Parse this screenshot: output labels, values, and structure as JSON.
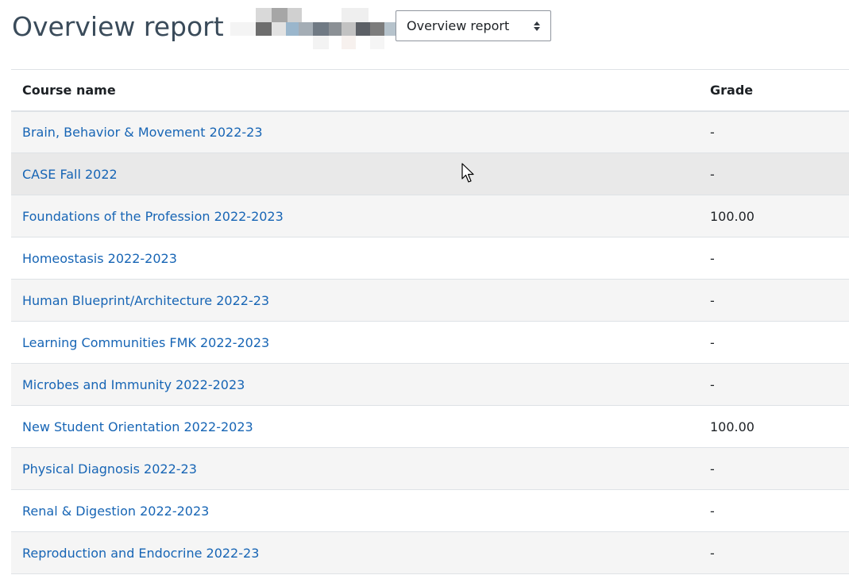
{
  "page": {
    "title": "Overview report"
  },
  "report_selector": {
    "selected": "Overview report"
  },
  "table": {
    "headers": {
      "course_name": "Course name",
      "grade": "Grade"
    },
    "rows": [
      {
        "course": "Brain, Behavior & Movement 2022-23",
        "grade": "-"
      },
      {
        "course": "CASE Fall 2022",
        "grade": "-"
      },
      {
        "course": "Foundations of the Profession 2022-2023",
        "grade": "100.00"
      },
      {
        "course": "Homeostasis 2022-2023",
        "grade": "-"
      },
      {
        "course": "Human Blueprint/Architecture 2022-23",
        "grade": "-"
      },
      {
        "course": "Learning Communities FMK 2022-2023",
        "grade": "-"
      },
      {
        "course": "Microbes and Immunity 2022-2023",
        "grade": "-"
      },
      {
        "course": "New Student Orientation 2022-2023",
        "grade": "100.00"
      },
      {
        "course": "Physical Diagnosis 2022-23",
        "grade": "-"
      },
      {
        "course": "Renal & Digestion 2022-2023",
        "grade": "-"
      },
      {
        "course": "Reproduction and Endocrine 2022-23",
        "grade": "-"
      }
    ]
  },
  "colors": {
    "link": "#1765b5",
    "title": "#3a4b5a",
    "stripe": "#f5f5f5",
    "hover": "#e9e9e9"
  },
  "icons": {
    "select_arrows": "updown-arrows-icon",
    "cursor": "mouse-pointer-icon"
  }
}
